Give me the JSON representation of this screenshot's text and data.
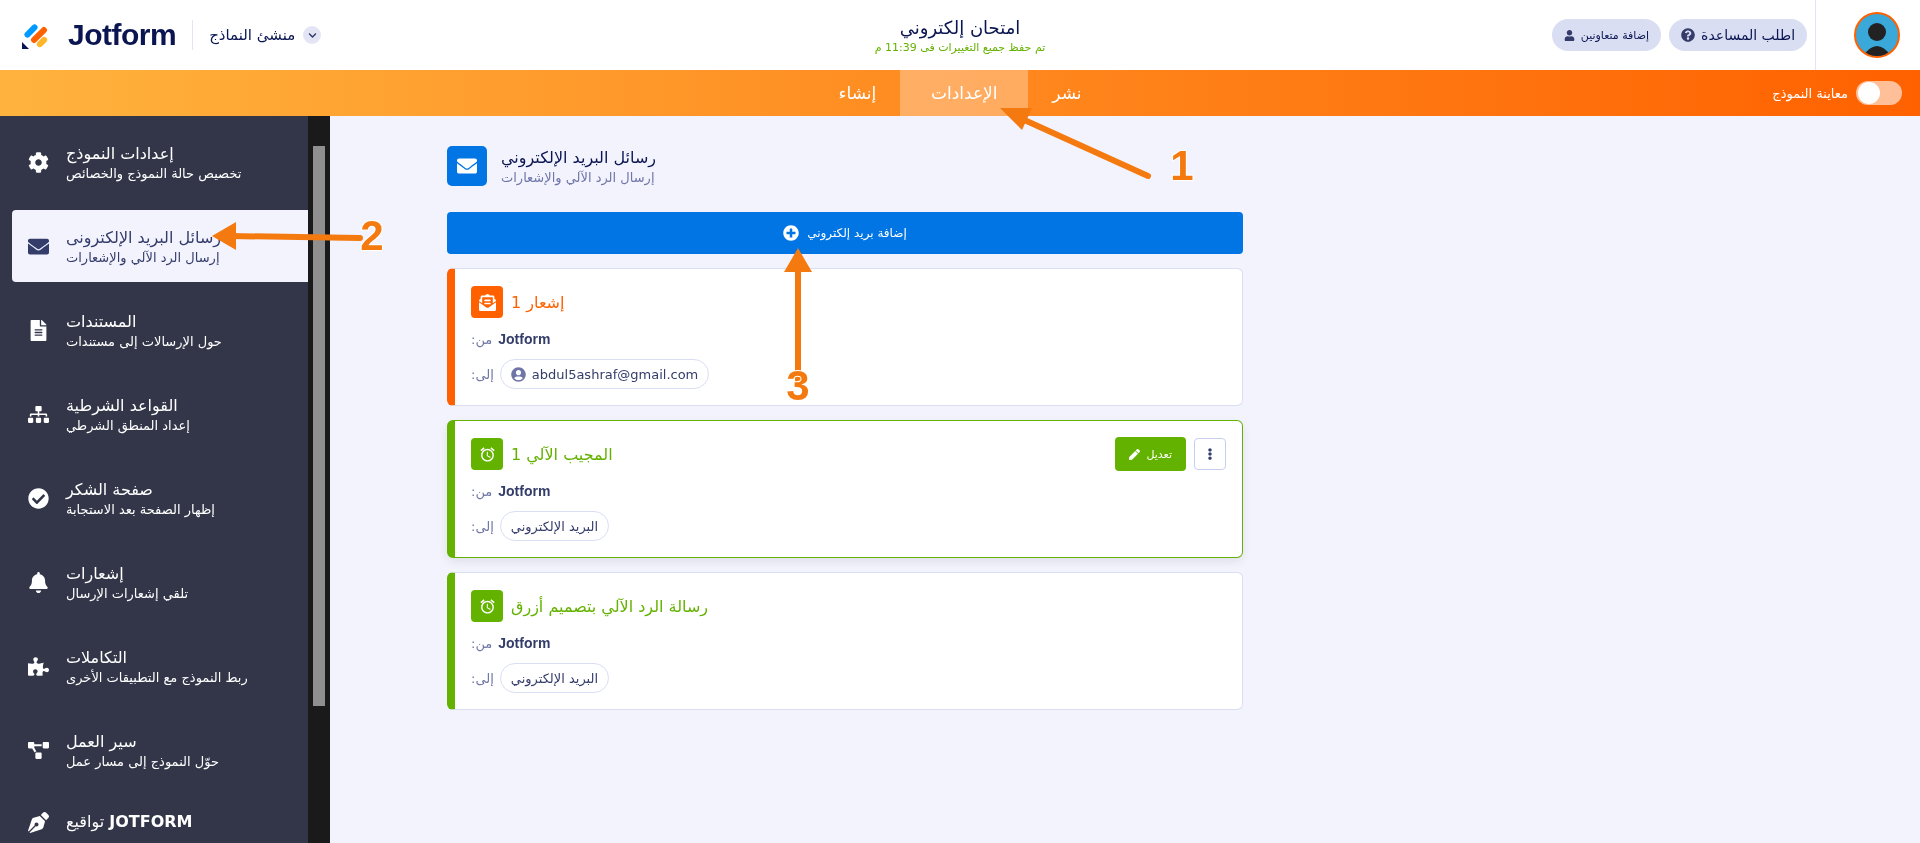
{
  "header": {
    "logo": "Jotform",
    "builder_menu": "منشئ النماذج",
    "form_title": "امتحان إلكتروني",
    "save_status": "تم حفظ جميع التغييرات فى 11:39 م",
    "buttons": [
      {
        "kind": "help",
        "label": "اطلب المساعدة"
      },
      {
        "kind": "collaborators",
        "label": "إضافة متعاونين"
      }
    ]
  },
  "tabs": [
    {
      "label": "نشر",
      "selected": false
    },
    {
      "label": "الإعدادات",
      "selected": true
    },
    {
      "label": "إنشاء",
      "selected": false
    }
  ],
  "preview": {
    "label": "معاينة النموذج",
    "on": false
  },
  "sidebar": {
    "items": [
      {
        "kind": "gear",
        "title": "إعدادات النموذج",
        "subtitle": "تخصيص حالة النموذج والخصائص",
        "selected": false
      },
      {
        "kind": "mail",
        "title": "رسائل البريد الإلكترونى",
        "subtitle": "إرسال الرد الآلي والإشعارات",
        "selected": true
      },
      {
        "kind": "document",
        "title": "المستندات",
        "subtitle": "حول الإرسالات إلى مستندات",
        "selected": false
      },
      {
        "kind": "sitemap",
        "title": "القواعد الشرطية",
        "subtitle": "إعداد المنطق الشرطي",
        "selected": false
      },
      {
        "kind": "check",
        "title": "صفحة الشكر",
        "subtitle": "إظهار الصفحة بعد الاستجابة",
        "selected": false
      },
      {
        "kind": "bell",
        "title": "إشعارات",
        "subtitle": "تلقي إشعارات الإرسال",
        "selected": false
      },
      {
        "kind": "puzzle",
        "title": "التكاملات",
        "subtitle": "ربط النموذج مع التطبيقات الأخرى",
        "selected": false
      },
      {
        "kind": "workflow",
        "title": "سير العمل",
        "subtitle": "حوّل النموذج إلى مسار عمل",
        "selected": false
      },
      {
        "kind": "pen",
        "title": "تواقيع **JOTFORM**",
        "selected": false
      }
    ]
  },
  "section": {
    "title": "رسائل البريد الإلكتروني",
    "subtitle": "إرسال الرد الآلي والإشعارات"
  },
  "add_button": "إضافة بريد إلكتروني",
  "emails": [
    {
      "kind": "notification",
      "color": "#ff6100",
      "title": "إشعار 1",
      "from_label": ":من",
      "from": "Jotform",
      "to_label": ":إلى",
      "to": {
        "kind": "user",
        "text": "abdul5ashraf@gmail.com"
      },
      "hovered": false
    },
    {
      "kind": "autoresponder",
      "color": "#64b200",
      "title": "المجيب الآلي 1",
      "from_label": ":من",
      "from": "Jotform",
      "to_label": ":إلى",
      "to": {
        "kind": "field",
        "text": "البريد الإلكتروني"
      },
      "hovered": true,
      "edit_label": "تعديل"
    },
    {
      "kind": "autoresponder",
      "color": "#64b200",
      "title": "رسالة الرد الآلي بتصميم أزرق",
      "from_label": ":من",
      "from": "Jotform",
      "to_label": ":إلى",
      "to": {
        "kind": "field",
        "text": "البريد الإلكتروني"
      },
      "hovered": false
    }
  ],
  "annotations": [
    {
      "label": "1"
    },
    {
      "label": "2"
    },
    {
      "label": "3"
    }
  ]
}
